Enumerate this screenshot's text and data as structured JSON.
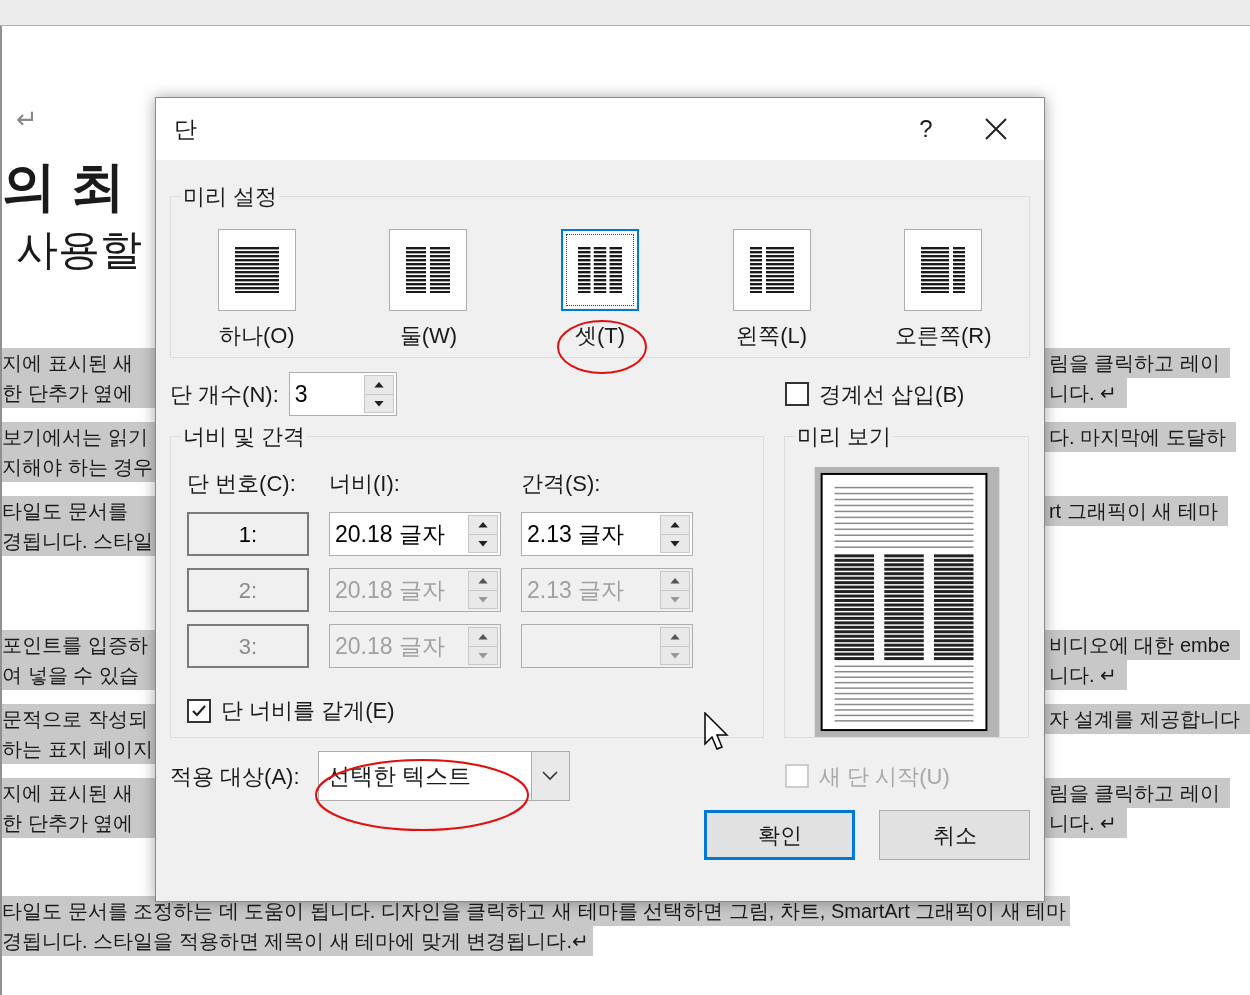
{
  "document": {
    "return_mark": "↵",
    "title_fragment": "의 최",
    "subtitle_fragment": "사용할",
    "sections": [
      {
        "paragraphs": [
          {
            "lines": [
              {
                "left": "지에 표시된 새",
                "right": "림을 클릭하고 레이",
                "highlighted": true
              },
              {
                "left": "한 단추가 옆에",
                "right": "니다. ↵",
                "highlighted": true
              }
            ]
          },
          {
            "lines": [
              {
                "left": "보기에서는 읽기",
                "right": "다. 마지막에 도달하",
                "highlighted": true
              },
              {
                "left": "지해야 하는 경우",
                "highlighted": true
              }
            ]
          },
          {
            "lines": [
              {
                "left": "타일도 문서를",
                "right": "rt 그래픽이 새 테마",
                "highlighted": true
              },
              {
                "left": "경됩니다. 스타일",
                "highlighted": true
              }
            ]
          }
        ]
      },
      {
        "paragraphs": [
          {
            "lines": [
              {
                "left": "포인트를 입증하",
                "right": "비디오에 대한 embe",
                "highlighted": true
              },
              {
                "left": "여 넣을 수 있습",
                "right": "니다. ↵",
                "highlighted": true
              }
            ]
          },
          {
            "lines": [
              {
                "left": "문적으로 작성되",
                "right": "자 설계를 제공합니다",
                "highlighted": true
              },
              {
                "left": "하는 표지 페이지",
                "highlighted": true
              }
            ]
          },
          {
            "lines": [
              {
                "left": "지에 표시된 새",
                "right": "림을 클릭하고 레이",
                "highlighted": true
              },
              {
                "left": "한 단추가 옆에",
                "right": "니다. ↵",
                "highlighted": true
              }
            ]
          }
        ]
      }
    ],
    "bottom_lines": [
      {
        "text": "타일도 문서를 조정하는 데 도움이 됩니다. 디자인을 클릭하고 새 테마를 선택하면 그림, 차트, SmartArt 그래픽이 새 테마",
        "highlighted": true
      },
      {
        "text": "경됩니다. 스타일을 적용하면 제목이 새 테마에 맞게 변경됩니다.↵",
        "highlighted": true
      }
    ]
  },
  "dialog": {
    "title": "단",
    "help": "?",
    "presets": {
      "legend": "미리 설정",
      "items": [
        {
          "label": "하나(O)",
          "kind": "one",
          "selected": false
        },
        {
          "label": "둘(W)",
          "kind": "two",
          "selected": false
        },
        {
          "label": "셋(T)",
          "kind": "three",
          "selected": true
        },
        {
          "label": "왼쪽(L)",
          "kind": "left",
          "selected": false
        },
        {
          "label": "오른쪽(R)",
          "kind": "right",
          "selected": false
        }
      ]
    },
    "column_count": {
      "label": "단 개수(N):",
      "value": "3"
    },
    "line_between": {
      "label": "경계선 삽입(B)",
      "checked": false
    },
    "width_spacing": {
      "legend": "너비 및 간격",
      "headers": [
        "단 번호(C):",
        "너비(I):",
        "간격(S):"
      ],
      "rows": [
        {
          "number": "1:",
          "width": "20.18 글자",
          "spacing": "2.13 글자",
          "disabled": false
        },
        {
          "number": "2:",
          "width": "20.18 글자",
          "spacing": "2.13 글자",
          "disabled": true
        },
        {
          "number": "3:",
          "width": "20.18 글자",
          "disabled": true
        }
      ]
    },
    "equal_width": {
      "label": "단 너비를 같게(E)",
      "checked": true
    },
    "preview": {
      "legend": "미리 보기"
    },
    "apply_to": {
      "label": "적용 대상(A):",
      "value": "선택한 텍스트"
    },
    "new_column": {
      "label": "새 단 시작(U)",
      "checked": false,
      "disabled": true
    },
    "buttons": [
      {
        "label": "확인",
        "default": true
      },
      {
        "label": "취소",
        "default": false
      }
    ]
  }
}
